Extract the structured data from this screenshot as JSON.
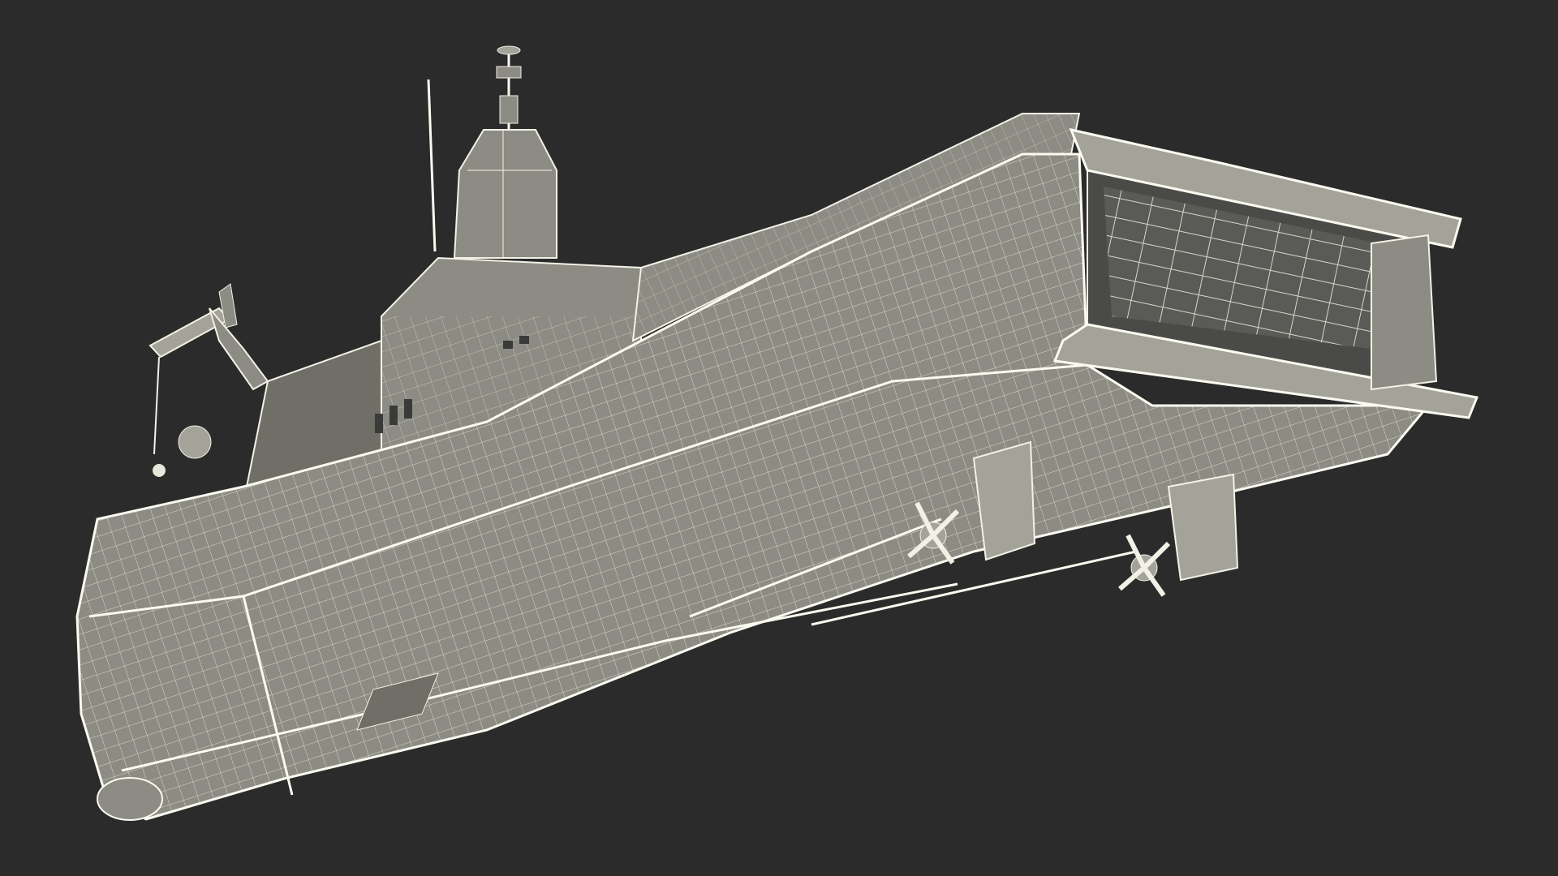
{
  "scene": {
    "background_color": "#2b2b2b",
    "hull_color": "#8c8c84",
    "wire_color": "#f2f1e6",
    "subject": "ship-wireframe-render"
  }
}
